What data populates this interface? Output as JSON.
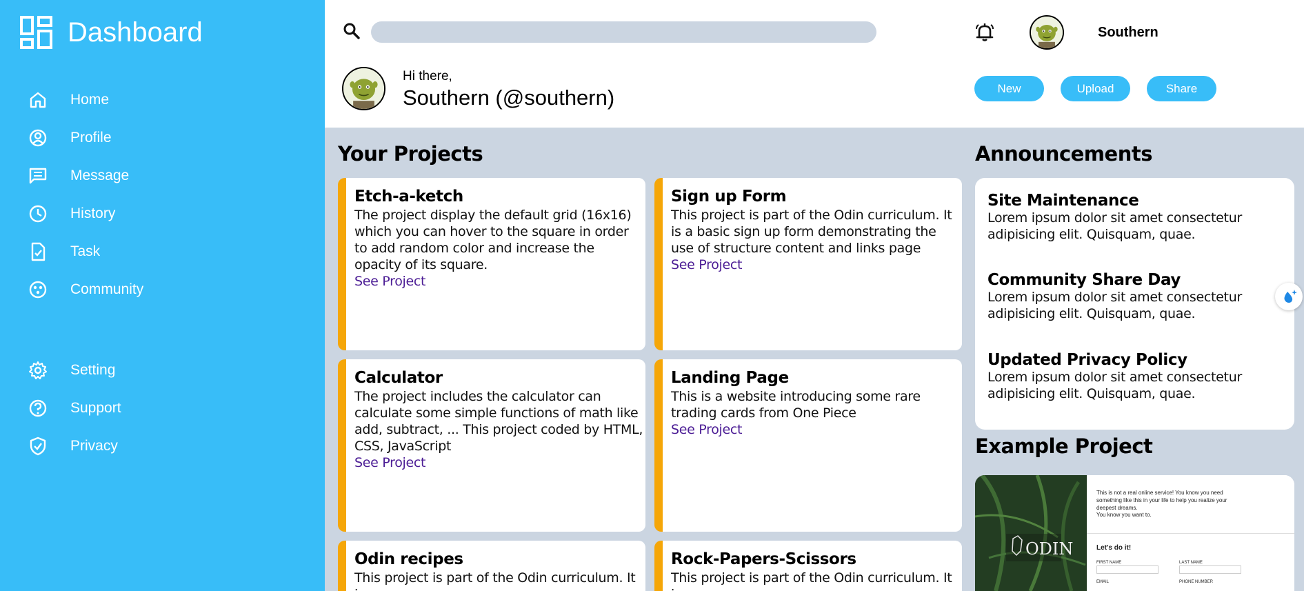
{
  "sidebar": {
    "brand": "Dashboard",
    "items": [
      {
        "label": "Home",
        "icon": "home-icon"
      },
      {
        "label": "Profile",
        "icon": "profile-icon"
      },
      {
        "label": "Message",
        "icon": "message-icon"
      },
      {
        "label": "History",
        "icon": "history-icon"
      },
      {
        "label": "Task",
        "icon": "task-icon"
      },
      {
        "label": "Community",
        "icon": "community-icon"
      }
    ],
    "bottom_items": [
      {
        "label": "Setting",
        "icon": "gear-icon"
      },
      {
        "label": "Support",
        "icon": "help-icon"
      },
      {
        "label": "Privacy",
        "icon": "shield-icon"
      }
    ]
  },
  "header": {
    "search_placeholder": "",
    "user_name": "Southern",
    "greeting": "Hi there,",
    "display_name": "Southern (@southern)",
    "buttons": {
      "new": "New",
      "upload": "Upload",
      "share": "Share"
    }
  },
  "projects": {
    "title": "Your Projects",
    "link_label": "See Project",
    "cards": [
      {
        "title": "Etch-a-ketch",
        "desc": "The project display the default grid (16x16) which you can hover to the square in order to add random color and increase the opacity of its square."
      },
      {
        "title": "Sign up Form",
        "desc": "This project is part of the Odin curriculum. It is a basic sign up form demonstrating the use of structure content and links page"
      },
      {
        "title": "Calculator",
        "desc": "The project includes the calculator can calculate some simple functions of math like add, subtract, ... This project coded by HTML, CSS, JavaScript"
      },
      {
        "title": "Landing Page",
        "desc": "This is a website introducing some rare trading cards from One Piece"
      },
      {
        "title": "Odin recipes",
        "desc": "This project is part of the Odin curriculum. It is"
      },
      {
        "title": "Rock-Papers-Scissors",
        "desc": "This project is part of the Odin curriculum. It is"
      }
    ]
  },
  "announcements": {
    "title": "Announcements",
    "items": [
      {
        "title": "Site Maintenance",
        "text": "Lorem ipsum dolor sit amet consectetur adipisicing elit. Quisquam, quae."
      },
      {
        "title": "Community Share Day",
        "text": "Lorem ipsum dolor sit amet consectetur adipisicing elit. Quisquam, quae."
      },
      {
        "title": "Updated Privacy Policy",
        "text": "Lorem ipsum dolor sit amet consectetur adipisicing elit. Quisquam, quae."
      }
    ]
  },
  "example": {
    "title": "Example Project",
    "logo_text": "ODIN",
    "line1": "This is not a real online service! You know you need something like this in your life to help you realize your deepest dreams.",
    "line2": "You know you want to.",
    "cta": "Let's do it!",
    "first_name": "FIRST NAME",
    "last_name": "LAST NAME",
    "email": "EMAIL",
    "phone": "PHONE NUMBER"
  },
  "colors": {
    "sidebar": "#38bdf8",
    "background": "#cbd5e1",
    "card_accent": "#f5a608",
    "link": "#4c1d95"
  }
}
